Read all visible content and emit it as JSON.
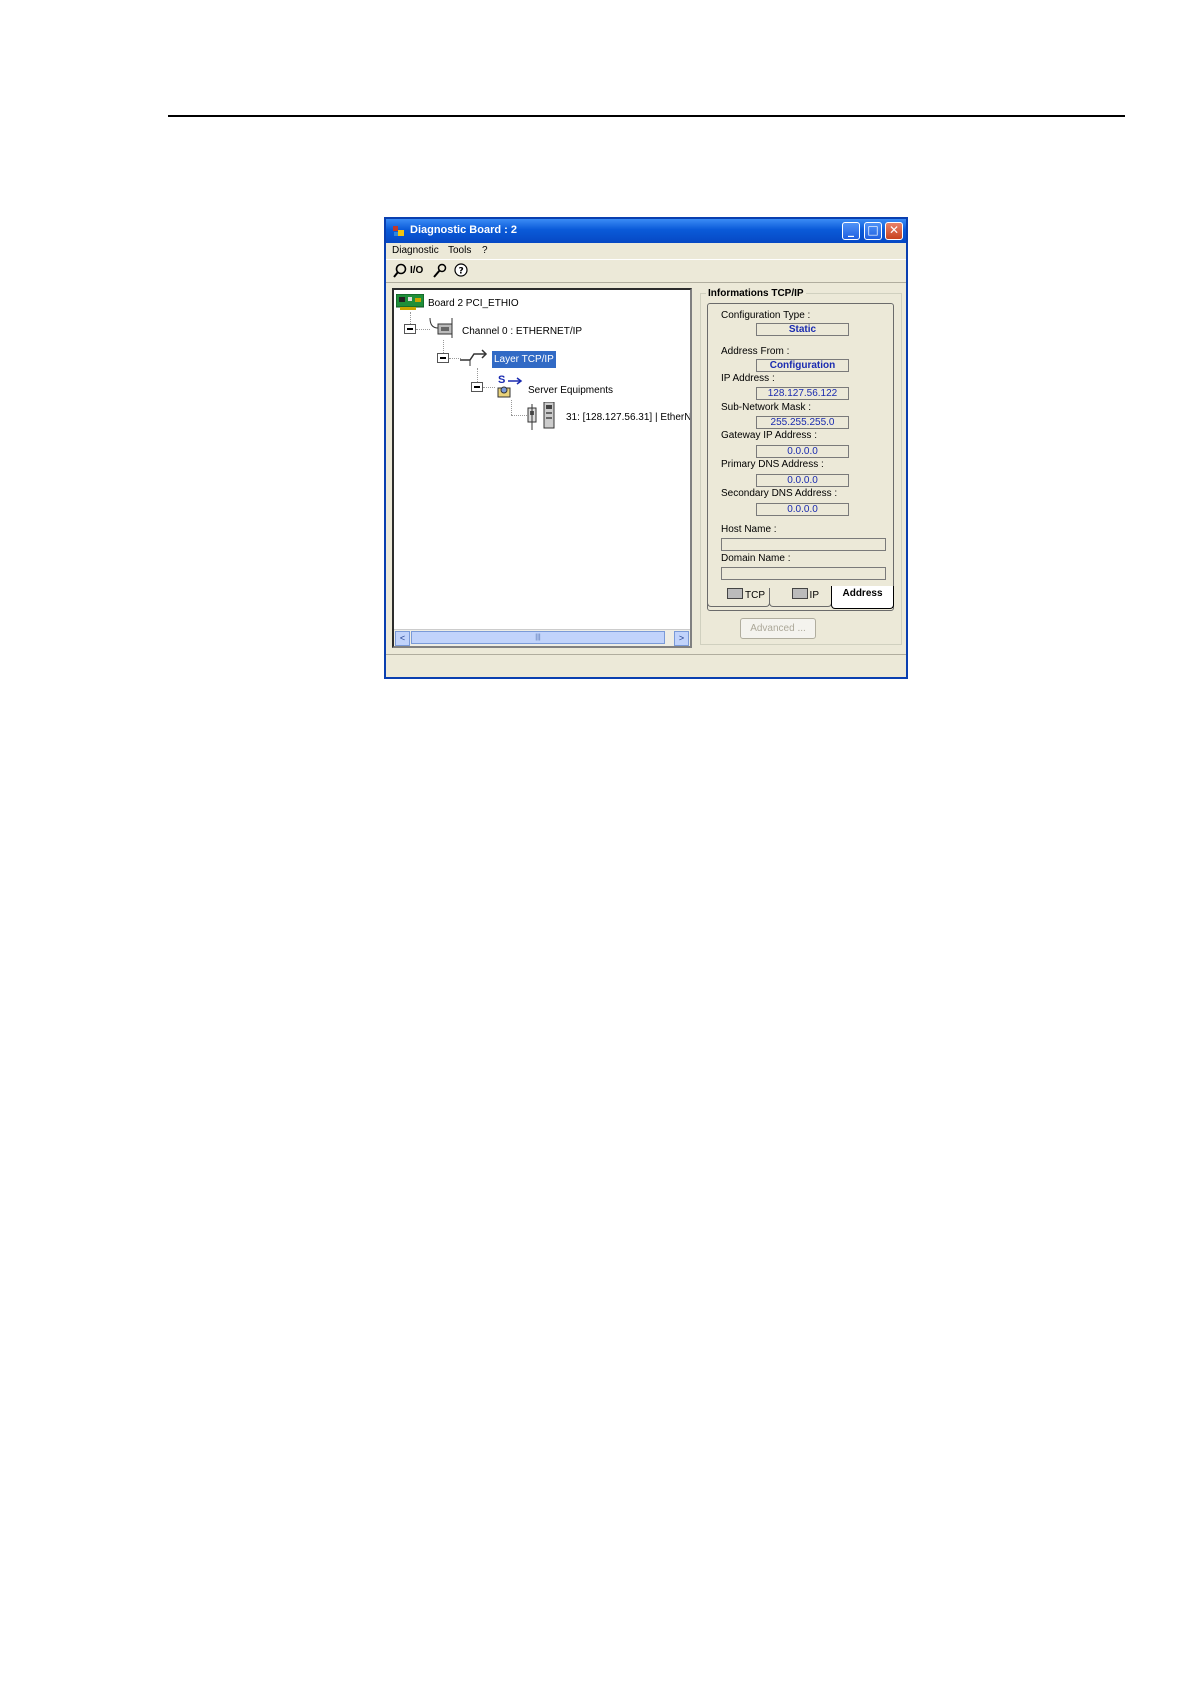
{
  "window": {
    "title": "Diagnostic Board : 2",
    "controls": {
      "minimize": "_",
      "maximize": "□",
      "close": "✕"
    }
  },
  "menu": [
    "Diagnostic",
    "Tools",
    "?"
  ],
  "toolbar": {
    "items": [
      {
        "icon": "search-icon"
      },
      {
        "label": "I/O",
        "icon": "io-icon"
      },
      {
        "icon": "wrench-icon"
      },
      {
        "icon": "help-icon"
      }
    ]
  },
  "tree": {
    "board": "Board 2 PCI_ETHIO",
    "channel": "Channel 0 : ETHERNET/IP",
    "layer": "Layer TCP/IP",
    "server": "Server  Equipments",
    "server_badge": "S",
    "equipment": "31: [128.127.56.31] | EtherN"
  },
  "scroll": {
    "left": "<",
    "right": ">",
    "grip": "|||"
  },
  "info": {
    "group_title": "Informations TCP/IP",
    "configuration_type": {
      "label": "Configuration Type :",
      "value": "Static"
    },
    "address_from": {
      "label": "Address From :",
      "value": "Configuration"
    },
    "ip_address": {
      "label": "IP Address :",
      "value": "128.127.56.122"
    },
    "subnet_mask": {
      "label": "Sub-Network Mask :",
      "value": "255.255.255.0"
    },
    "gateway": {
      "label": "Gateway IP Address :",
      "value": "0.0.0.0"
    },
    "primary_dns": {
      "label": "Primary DNS Address :",
      "value": "0.0.0.0"
    },
    "secondary_dns": {
      "label": "Secondary DNS Address :",
      "value": "0.0.0.0"
    },
    "host_name": {
      "label": "Host Name :",
      "value": ""
    },
    "domain_name": {
      "label": "Domain Name :",
      "value": ""
    }
  },
  "tabs": [
    "TCP",
    "IP",
    "Address"
  ],
  "active_tab": "Address",
  "advanced_button": "Advanced ...",
  "colors": {
    "titlebar": "#0a5ad8",
    "selection": "#316ac5",
    "value_text": "#1a2bb0"
  }
}
